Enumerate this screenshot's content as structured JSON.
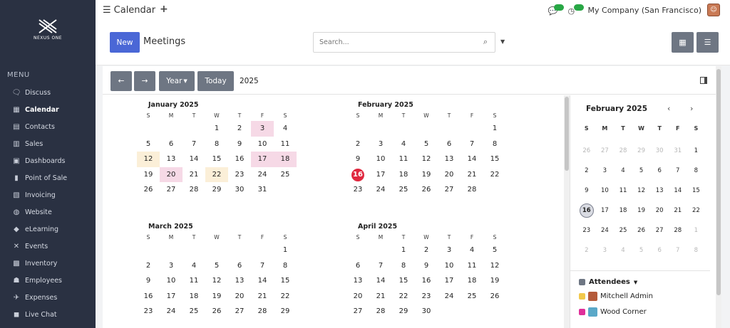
{
  "sidebar": {
    "logo_text": "NEXUS ONE",
    "menu_title": "MENU",
    "items": [
      {
        "label": "Discuss",
        "icon": "chat-icon"
      },
      {
        "label": "Calendar",
        "icon": "calendar-icon",
        "active": true
      },
      {
        "label": "Contacts",
        "icon": "contacts-icon"
      },
      {
        "label": "Sales",
        "icon": "sales-icon"
      },
      {
        "label": "Dashboards",
        "icon": "dashboard-icon"
      },
      {
        "label": "Point of Sale",
        "icon": "store-icon"
      },
      {
        "label": "Invoicing",
        "icon": "invoice-icon"
      },
      {
        "label": "Website",
        "icon": "globe-icon"
      },
      {
        "label": "eLearning",
        "icon": "elearning-icon"
      },
      {
        "label": "Events",
        "icon": "events-icon"
      },
      {
        "label": "Inventory",
        "icon": "inventory-icon"
      },
      {
        "label": "Employees",
        "icon": "employees-icon"
      },
      {
        "label": "Expenses",
        "icon": "expenses-icon"
      },
      {
        "label": "Live Chat",
        "icon": "livechat-icon"
      }
    ]
  },
  "topbar": {
    "title": "Calendar",
    "company": "My Company (San Francisco)"
  },
  "controls": {
    "new_label": "New",
    "page_title": "Meetings",
    "search_placeholder": "Search..."
  },
  "nav": {
    "prev": "←",
    "next": "→",
    "scale": "Year",
    "today": "Today",
    "year": "2025"
  },
  "dow": [
    "S",
    "M",
    "T",
    "W",
    "T",
    "F",
    "S"
  ],
  "months": [
    {
      "title": "January 2025",
      "weeks": [
        [
          "",
          "",
          "",
          "1",
          "2",
          "3",
          "4"
        ],
        [
          "5",
          "6",
          "7",
          "8",
          "9",
          "10",
          "11"
        ],
        [
          "12",
          "13",
          "14",
          "15",
          "16",
          "17",
          "18"
        ],
        [
          "19",
          "20",
          "21",
          "22",
          "23",
          "24",
          "25"
        ],
        [
          "26",
          "27",
          "28",
          "29",
          "30",
          "31",
          ""
        ]
      ],
      "pink": [
        "3",
        "17",
        "18",
        "20"
      ],
      "yellow": [
        "12",
        "22"
      ]
    },
    {
      "title": "February 2025",
      "weeks": [
        [
          "",
          "",
          "",
          "",
          "",
          "",
          "1"
        ],
        [
          "2",
          "3",
          "4",
          "5",
          "6",
          "7",
          "8"
        ],
        [
          "9",
          "10",
          "11",
          "12",
          "13",
          "14",
          "15"
        ],
        [
          "16",
          "17",
          "18",
          "19",
          "20",
          "21",
          "22"
        ],
        [
          "23",
          "24",
          "25",
          "26",
          "27",
          "28",
          ""
        ]
      ],
      "today": "16"
    },
    {
      "title": "March 2025",
      "weeks": [
        [
          "",
          "",
          "",
          "",
          "",
          "",
          "1"
        ],
        [
          "2",
          "3",
          "4",
          "5",
          "6",
          "7",
          "8"
        ],
        [
          "9",
          "10",
          "11",
          "12",
          "13",
          "14",
          "15"
        ],
        [
          "16",
          "17",
          "18",
          "19",
          "20",
          "21",
          "22"
        ],
        [
          "23",
          "24",
          "25",
          "26",
          "27",
          "28",
          "29"
        ]
      ]
    },
    {
      "title": "April 2025",
      "weeks": [
        [
          "",
          "",
          "1",
          "2",
          "3",
          "4",
          "5"
        ],
        [
          "6",
          "7",
          "8",
          "9",
          "10",
          "11",
          "12"
        ],
        [
          "13",
          "14",
          "15",
          "16",
          "17",
          "18",
          "19"
        ],
        [
          "20",
          "21",
          "22",
          "23",
          "24",
          "25",
          "26"
        ],
        [
          "27",
          "28",
          "29",
          "30",
          "",
          "",
          ""
        ]
      ]
    }
  ],
  "mini_calendar": {
    "title": "February 2025",
    "prev": "‹",
    "next": "›",
    "days": [
      [
        "26",
        "27",
        "28",
        "29",
        "30",
        "31",
        "1"
      ],
      [
        "2",
        "3",
        "4",
        "5",
        "6",
        "7",
        "8"
      ],
      [
        "9",
        "10",
        "11",
        "12",
        "13",
        "14",
        "15"
      ],
      [
        "16",
        "17",
        "18",
        "19",
        "20",
        "21",
        "22"
      ],
      [
        "23",
        "24",
        "25",
        "26",
        "27",
        "28",
        "1"
      ],
      [
        "2",
        "3",
        "4",
        "5",
        "6",
        "7",
        "8"
      ]
    ],
    "muted_first_row": 6,
    "muted_fifth_row_last": 1,
    "selected": "16"
  },
  "attendees": {
    "heading": "Attendees",
    "items": [
      {
        "name": "Mitchell Admin",
        "checkbox_color": "#f2c94c",
        "avatar_color": "#b55b3a"
      },
      {
        "name": "Wood Corner",
        "checkbox_color": "#e0309a",
        "avatar_color": "#5aa8c8"
      }
    ]
  },
  "colors": {
    "sidebar_bg": "#2a3142",
    "primary": "#4a67d6",
    "secondary_btn": "#6e7683",
    "today": "#e0283f",
    "event_pink": "#f6d9e6",
    "event_yellow": "#fbefd8"
  }
}
